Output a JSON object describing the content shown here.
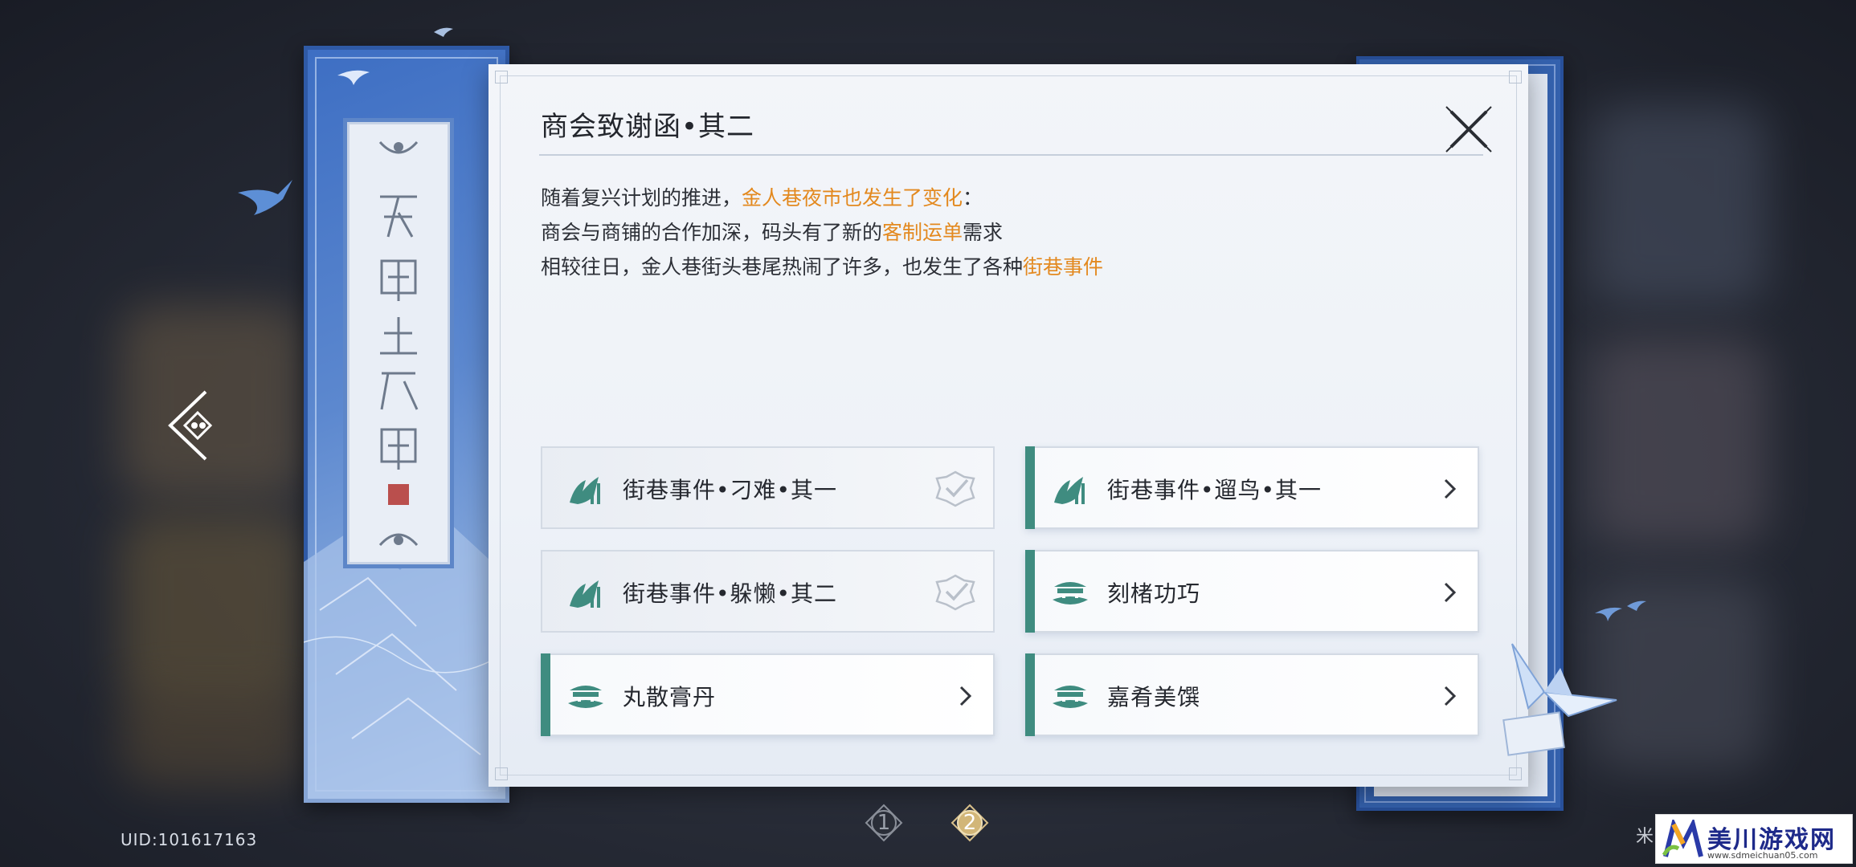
{
  "dialog": {
    "title": "商会致谢函•其二",
    "description": {
      "line1_prefix": "随着复兴计划的推进，",
      "line1_highlight": "金人巷夜市也发生了变化",
      "line1_suffix": "：",
      "line2_prefix": "商会与商铺的合作加深，码头有了新的",
      "line2_highlight": "客制运单",
      "line2_suffix": "需求",
      "line3_prefix": "相较往日，金人巷街头巷尾热闹了许多，也发生了各种",
      "line3_highlight": "街巷事件"
    },
    "tasks": [
      {
        "label": "街巷事件•刁难•其一",
        "status": "completed",
        "icon": "alley-event-icon"
      },
      {
        "label": "街巷事件•遛鸟•其一",
        "status": "available",
        "icon": "alley-event-icon"
      },
      {
        "label": "街巷事件•躲懒•其二",
        "status": "completed",
        "icon": "alley-event-icon"
      },
      {
        "label": "刻楮功巧",
        "status": "available",
        "icon": "shop-icon"
      },
      {
        "label": "丸散膏丹",
        "status": "available",
        "icon": "shop-icon"
      },
      {
        "label": "嘉肴美馔",
        "status": "available",
        "icon": "shop-icon"
      }
    ]
  },
  "pagination": {
    "pages": [
      "1",
      "2"
    ],
    "current": "2"
  },
  "uid": "UID:101617163",
  "watermark": {
    "title": "美川游戏网",
    "url": "www.sdmeichuan05.com",
    "left_text": "米"
  },
  "colors": {
    "highlight": "#e3891f",
    "accent": "#3f8c80",
    "scroll_blue": "#3d6ec3"
  }
}
